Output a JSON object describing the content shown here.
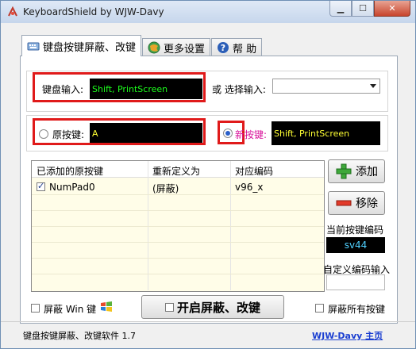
{
  "window": {
    "title": "KeyboardShield by WJW-Davy"
  },
  "tabs": [
    {
      "label": "键盘按键屏蔽、改键",
      "icon": "keyboard-icon",
      "active": true
    },
    {
      "label": "更多设置",
      "icon": "globe-icon",
      "active": false
    },
    {
      "label": "帮 助",
      "icon": "help-icon",
      "active": false
    }
  ],
  "keyboard_input": {
    "label": "键盘输入:",
    "value": "Shift, PrintScreen"
  },
  "or_select": {
    "label": "或 选择输入:",
    "value": ""
  },
  "original_key": {
    "label": "原按键:",
    "value": "A",
    "selected": false
  },
  "new_key": {
    "label": "新按键:",
    "value": "Shift, PrintScreen",
    "selected": true
  },
  "table": {
    "headers": [
      "已添加的原按键",
      "重新定义为",
      "对应编码"
    ],
    "rows": [
      {
        "checked": true,
        "original": "NumPad0",
        "redefined": "(屏蔽)",
        "code": "v96_x"
      }
    ]
  },
  "buttons": {
    "add": "添加",
    "remove": "移除",
    "start": "开启屏蔽、改键"
  },
  "current_code": {
    "label": "当前按键编码",
    "value": "sv44"
  },
  "custom_code": {
    "label": "自定义编码输入",
    "value": ""
  },
  "options": {
    "block_win": "屏蔽 Win 键",
    "block_all": "屏蔽所有按键"
  },
  "footer": {
    "version": "键盘按键屏蔽、改键软件 1.7",
    "link": "WJW-Davy 主页"
  },
  "colors": {
    "highlight_red": "#e01a1a",
    "field_green": "#1cff1c",
    "field_yellow": "#ffff33",
    "code_cyan": "#4fd0ff",
    "new_key_label": "#d8109a"
  }
}
